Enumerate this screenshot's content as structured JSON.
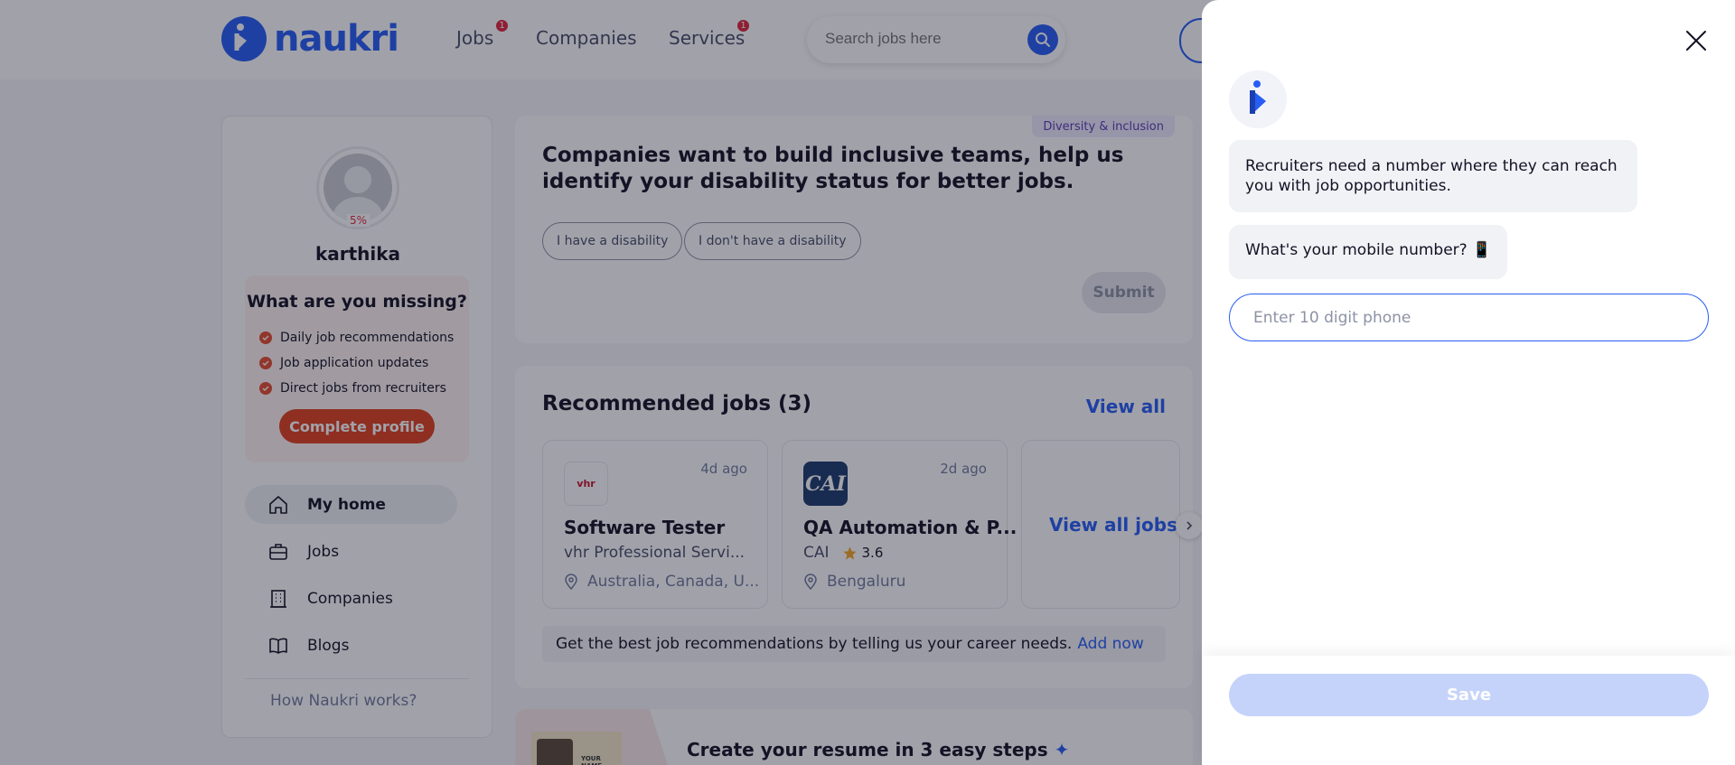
{
  "header": {
    "logo_text": "naukri",
    "nav": [
      {
        "label": "Jobs",
        "badge": "1"
      },
      {
        "label": "Companies",
        "badge": ""
      },
      {
        "label": "Services",
        "badge": "1"
      }
    ],
    "search_placeholder": "Search jobs here"
  },
  "profile": {
    "completion": "5%",
    "name": "karthika",
    "missing_title": "What are you missing?",
    "missing_items": [
      "Daily job recommendations",
      "Job application updates",
      "Direct jobs from recruiters"
    ],
    "complete_button": "Complete profile"
  },
  "side_nav": {
    "items": [
      {
        "label": "My home",
        "icon": "home-icon",
        "active": true
      },
      {
        "label": "Jobs",
        "icon": "briefcase-icon",
        "active": false
      },
      {
        "label": "Companies",
        "icon": "building-icon",
        "active": false
      },
      {
        "label": "Blogs",
        "icon": "book-icon",
        "active": false
      }
    ],
    "how_link": "How Naukri works?"
  },
  "disability": {
    "tag": "Diversity & inclusion",
    "title": "Companies want to build inclusive teams, help us identify your disability status for better jobs.",
    "options": [
      "I have a disability",
      "I don't have a disability"
    ],
    "submit": "Submit"
  },
  "recommended": {
    "title": "Recommended jobs (3)",
    "view_all": "View all",
    "jobs": [
      {
        "logo": "vhr",
        "age": "4d ago",
        "title": "Software Tester",
        "company": "vhr Professional Servi...",
        "rating": "",
        "location": "Australia, Canada, U..."
      },
      {
        "logo": "CAI",
        "age": "2d ago",
        "title": "QA Automation & P...",
        "company": "CAI",
        "rating": "3.6",
        "location": "Bengaluru"
      }
    ],
    "view_all_jobs": "View all jobs",
    "banner_text": "Get the best job recommendations by telling us your career needs.",
    "banner_link": "Add now"
  },
  "resume": {
    "title": "Create your resume in 3 easy steps",
    "image_text": "YOUR NAME"
  },
  "drawer": {
    "message1": "Recruiters need a number where they can reach you with job opportunities.",
    "message2": "What's your mobile number? 📱",
    "phone_placeholder": "Enter 10 digit phone",
    "phone_value": "",
    "save": "Save"
  },
  "colors": {
    "brand": "#275df5",
    "accent": "#e0401e",
    "badge": "#e0263d"
  }
}
